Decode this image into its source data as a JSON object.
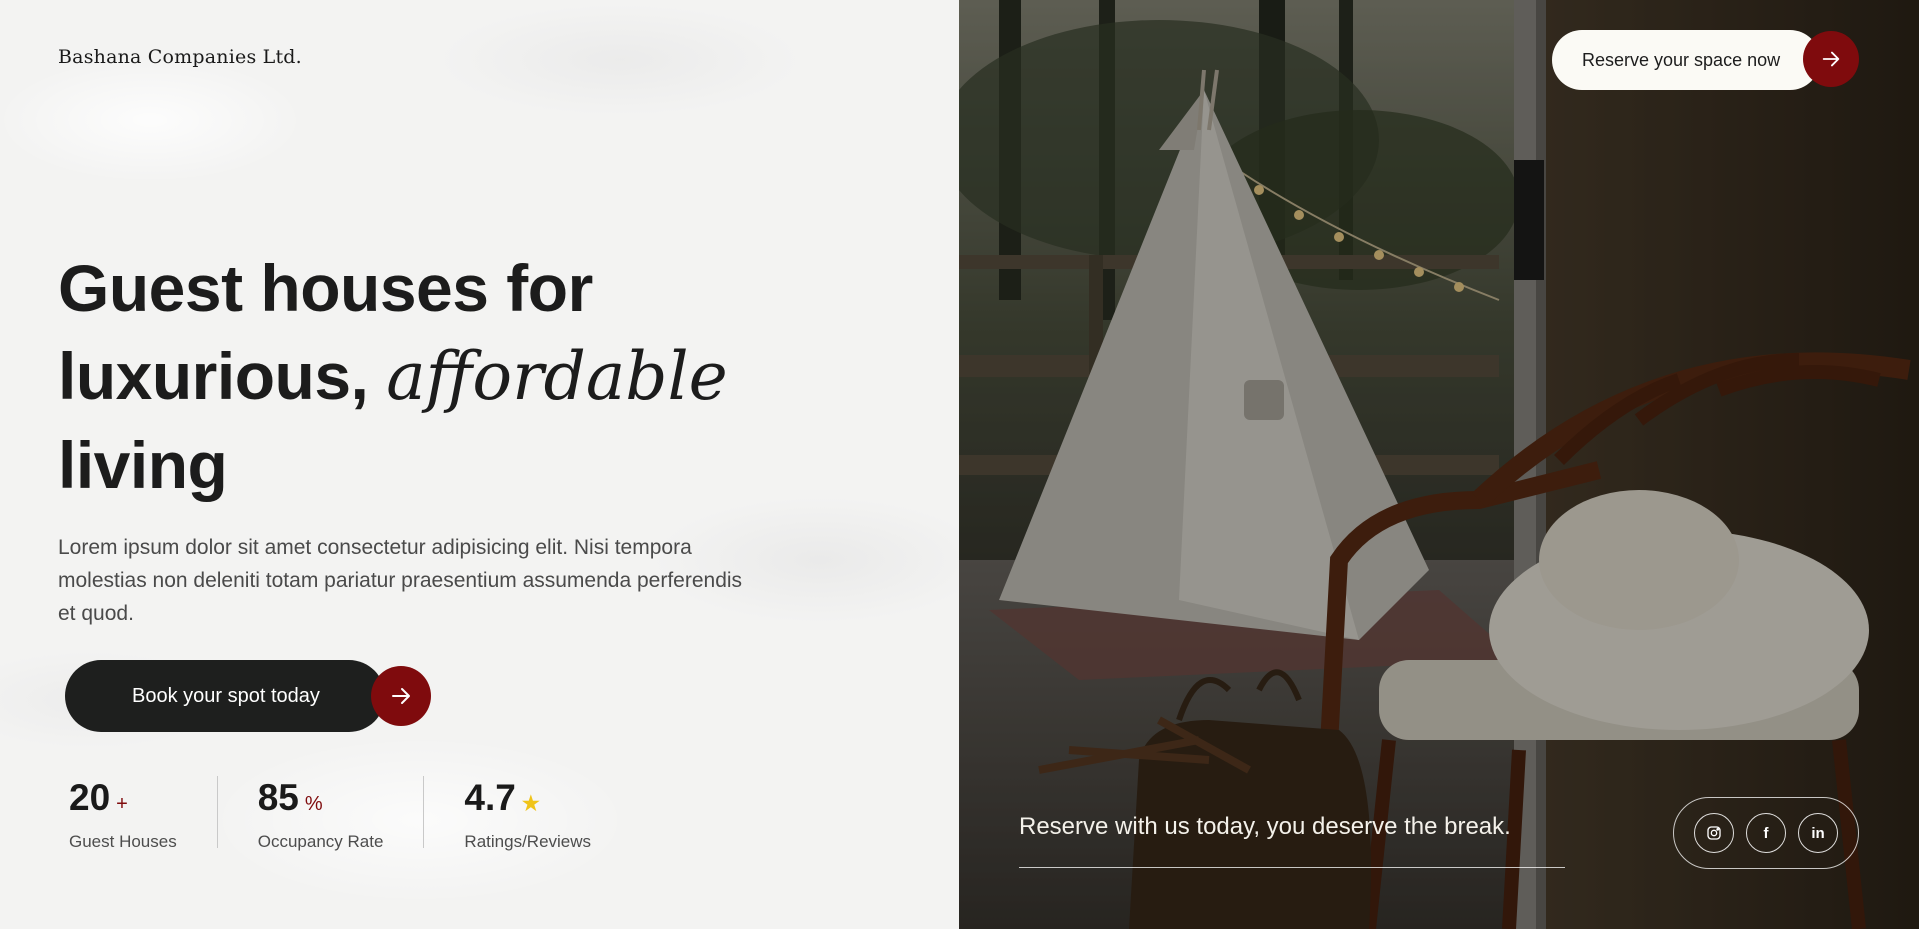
{
  "brand": {
    "name": "Bashana Companies Ltd."
  },
  "hero": {
    "headline_line1": "Guest houses for",
    "headline_line2_a": "luxurious, ",
    "headline_line2_b": "affordable",
    "headline_line3": "living",
    "description": "Lorem ipsum dolor sit amet consectetur adipisicing elit. Nisi tempora molestias non deleniti totam pariatur praesentium assumenda perferendis et quod.",
    "cta_label": "Book your spot today"
  },
  "stats": [
    {
      "value": "20",
      "suffix": "+",
      "label": "Guest Houses"
    },
    {
      "value": "85",
      "suffix": "%",
      "label": "Occupancy Rate"
    },
    {
      "value": "4.7",
      "suffix": "",
      "icon": "star-icon",
      "label": "Ratings/Reviews"
    }
  ],
  "header": {
    "reserve_label": "Reserve your space now"
  },
  "photo_panel": {
    "tagline": "Reserve with us today, you deserve the break.",
    "social": [
      {
        "icon": "instagram-icon"
      },
      {
        "icon": "facebook-icon",
        "glyph": "f"
      },
      {
        "icon": "linkedin-icon",
        "glyph": "in"
      }
    ]
  },
  "colors": {
    "accent": "#7f0b0d",
    "dark": "#1e1f1e",
    "pill": "#fbfaf5",
    "star": "#f0c419"
  }
}
